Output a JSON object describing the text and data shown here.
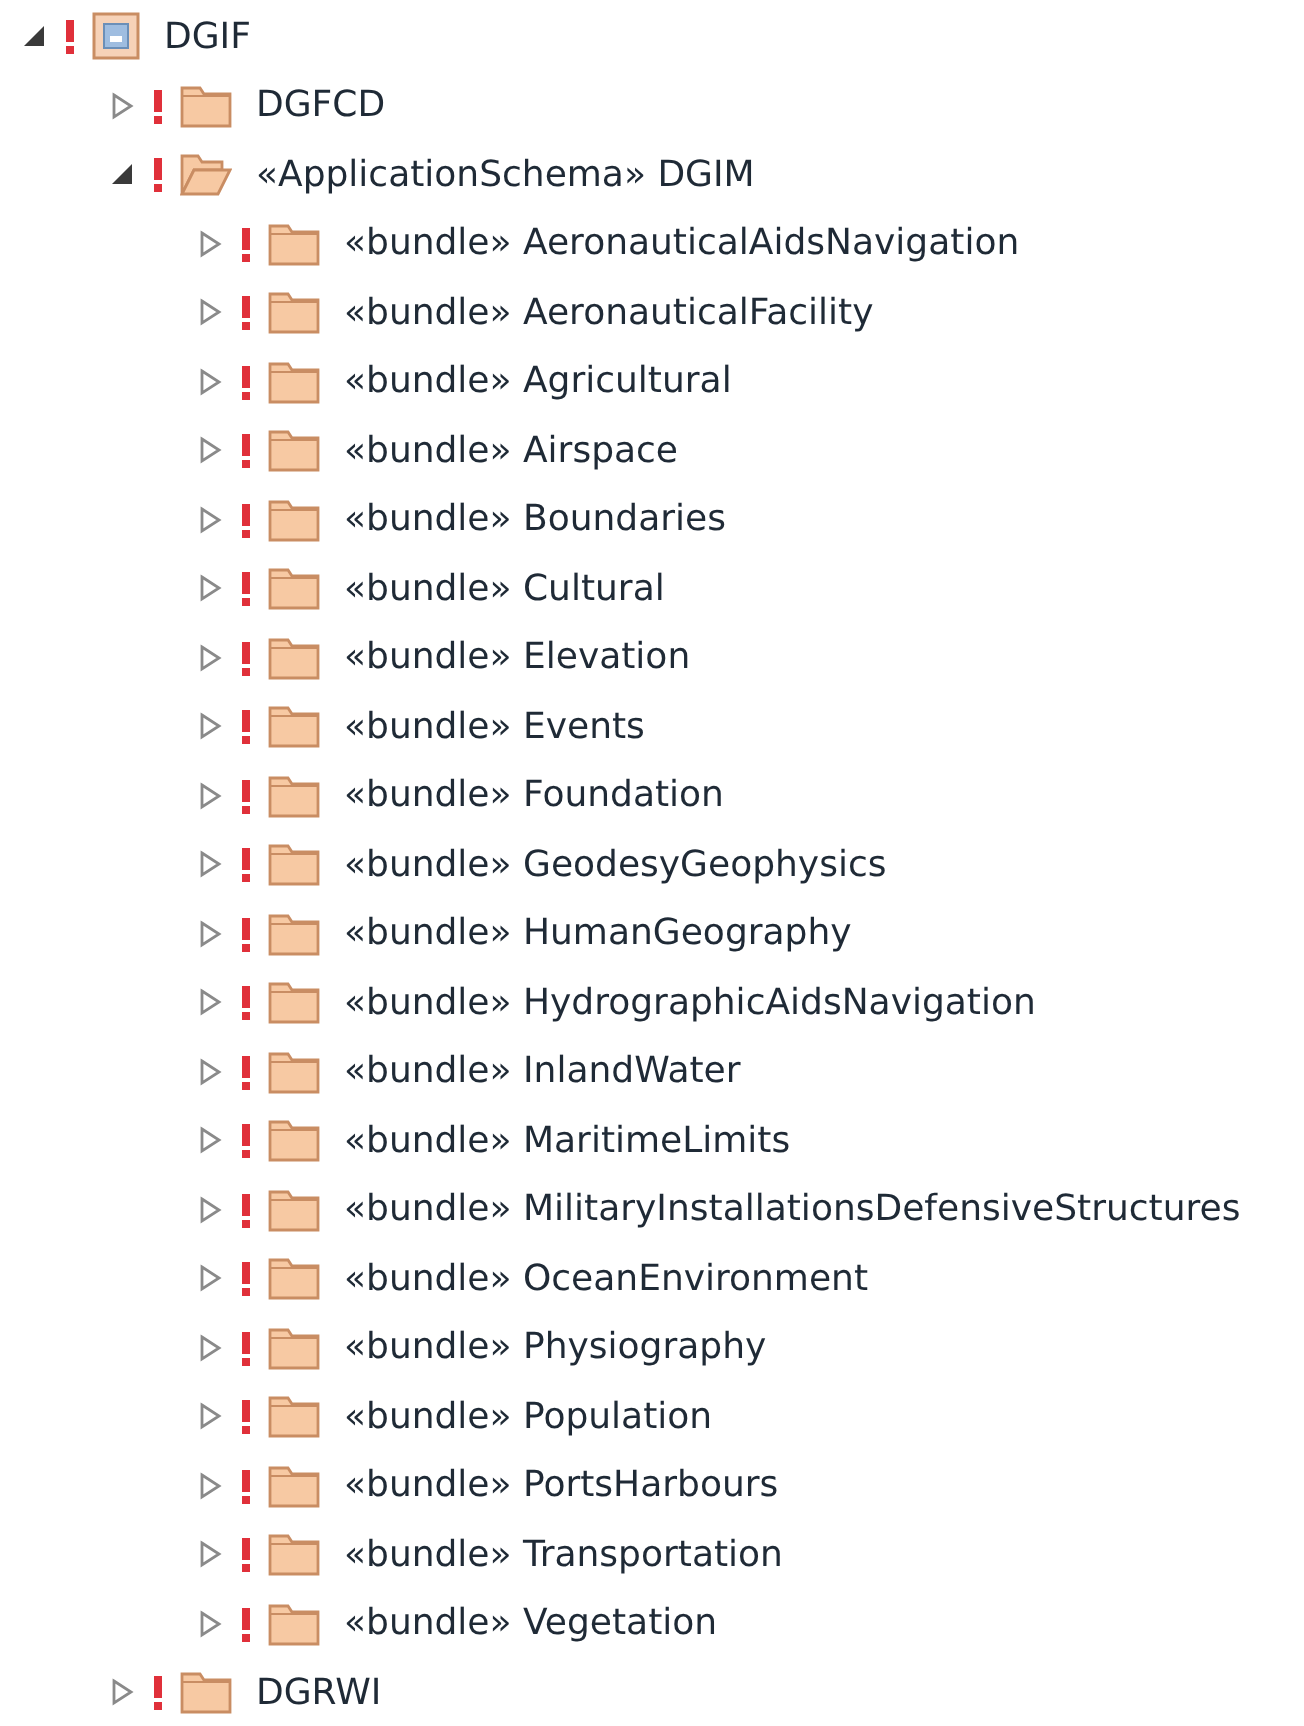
{
  "tree": [
    {
      "label": "DGIF",
      "kind": "model",
      "expanded": true,
      "error": true,
      "children": [
        {
          "label": "DGFCD",
          "kind": "folder",
          "expanded": false,
          "error": true
        },
        {
          "label": "«ApplicationSchema» DGIM",
          "kind": "folder",
          "expanded": true,
          "error": true,
          "children": [
            {
              "label": "«bundle» AeronauticalAidsNavigation",
              "kind": "folder",
              "expanded": false,
              "error": true
            },
            {
              "label": "«bundle» AeronauticalFacility",
              "kind": "folder",
              "expanded": false,
              "error": true
            },
            {
              "label": "«bundle» Agricultural",
              "kind": "folder",
              "expanded": false,
              "error": true
            },
            {
              "label": "«bundle» Airspace",
              "kind": "folder",
              "expanded": false,
              "error": true
            },
            {
              "label": "«bundle» Boundaries",
              "kind": "folder",
              "expanded": false,
              "error": true
            },
            {
              "label": "«bundle» Cultural",
              "kind": "folder",
              "expanded": false,
              "error": true
            },
            {
              "label": "«bundle» Elevation",
              "kind": "folder",
              "expanded": false,
              "error": true
            },
            {
              "label": "«bundle» Events",
              "kind": "folder",
              "expanded": false,
              "error": true
            },
            {
              "label": "«bundle» Foundation",
              "kind": "folder",
              "expanded": false,
              "error": true
            },
            {
              "label": "«bundle» GeodesyGeophysics",
              "kind": "folder",
              "expanded": false,
              "error": true
            },
            {
              "label": "«bundle» HumanGeography",
              "kind": "folder",
              "expanded": false,
              "error": true
            },
            {
              "label": "«bundle» HydrographicAidsNavigation",
              "kind": "folder",
              "expanded": false,
              "error": true
            },
            {
              "label": "«bundle» InlandWater",
              "kind": "folder",
              "expanded": false,
              "error": true
            },
            {
              "label": "«bundle» MaritimeLimits",
              "kind": "folder",
              "expanded": false,
              "error": true
            },
            {
              "label": "«bundle» MilitaryInstallationsDefensiveStructures",
              "kind": "folder",
              "expanded": false,
              "error": true
            },
            {
              "label": "«bundle» OceanEnvironment",
              "kind": "folder",
              "expanded": false,
              "error": true
            },
            {
              "label": "«bundle» Physiography",
              "kind": "folder",
              "expanded": false,
              "error": true
            },
            {
              "label": "«bundle» Population",
              "kind": "folder",
              "expanded": false,
              "error": true
            },
            {
              "label": "«bundle» PortsHarbours",
              "kind": "folder",
              "expanded": false,
              "error": true
            },
            {
              "label": "«bundle» Transportation",
              "kind": "folder",
              "expanded": false,
              "error": true
            },
            {
              "label": "«bundle» Vegetation",
              "kind": "folder",
              "expanded": false,
              "error": true
            }
          ]
        },
        {
          "label": "DGRWI",
          "kind": "folder",
          "expanded": false,
          "error": true
        }
      ]
    }
  ]
}
